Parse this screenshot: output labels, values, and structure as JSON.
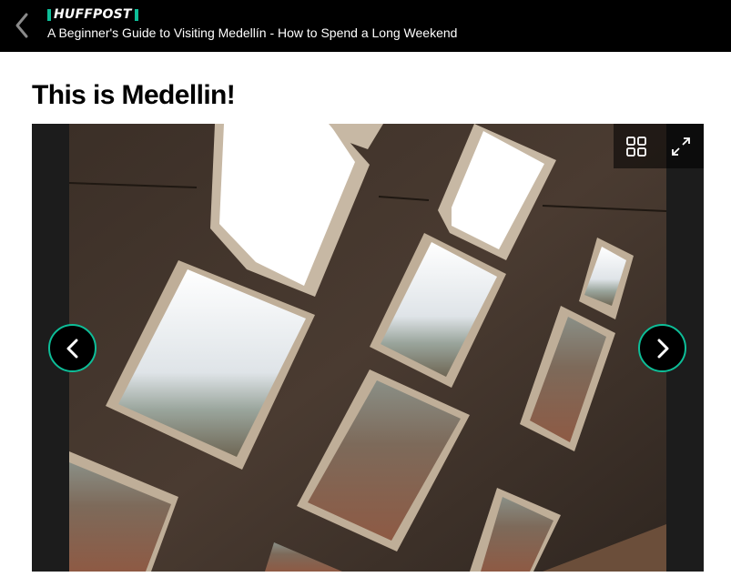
{
  "header": {
    "brand": "HUFFPOST",
    "article_title": "A Beginner's Guide to Visiting Medellín - How to Spend a Long Weekend"
  },
  "slide": {
    "title": "This is Medellin!"
  },
  "gallery": {
    "controls": [
      "grid-icon",
      "expand-icon"
    ],
    "nav": [
      "chevron-left-icon",
      "chevron-right-icon"
    ]
  },
  "colors": {
    "accent": "#0dbe98",
    "header_bg": "#000000",
    "gallery_bg": "#1c1c1c"
  }
}
